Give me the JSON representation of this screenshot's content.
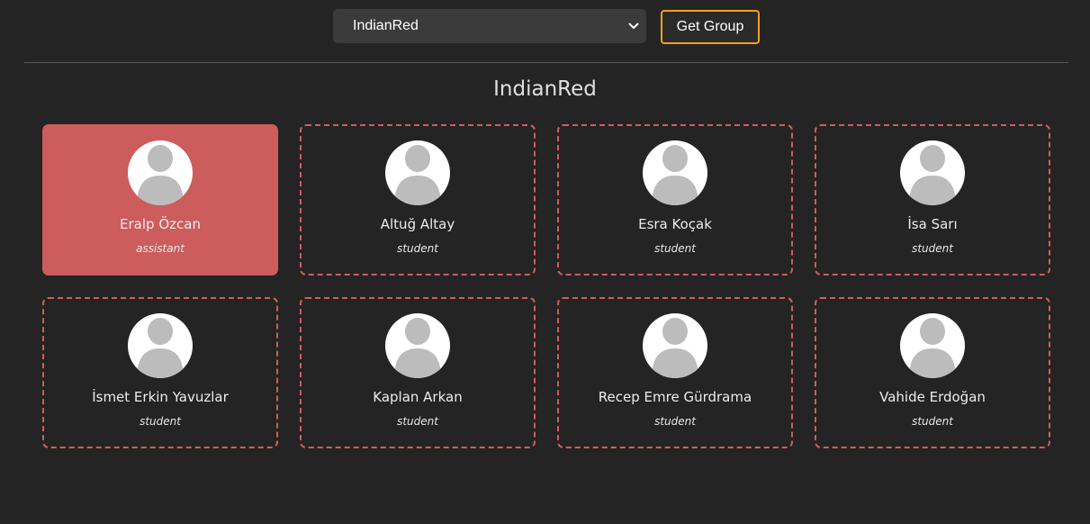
{
  "controls": {
    "group_select_value": "IndianRed",
    "get_group_label": "Get Group"
  },
  "group": {
    "title": "IndianRed",
    "accent_color": "#cd5c5c"
  },
  "members": [
    {
      "name": "Eralp Özcan",
      "role": "assistant",
      "highlighted": true
    },
    {
      "name": "Altuğ Altay",
      "role": "student",
      "highlighted": false
    },
    {
      "name": "Esra Koçak",
      "role": "student",
      "highlighted": false
    },
    {
      "name": "İsa Sarı",
      "role": "student",
      "highlighted": false
    },
    {
      "name": "İsmet Erkin Yavuzlar",
      "role": "student",
      "highlighted": false
    },
    {
      "name": "Kaplan Arkan",
      "role": "student",
      "highlighted": false
    },
    {
      "name": "Recep Emre Gürdrama",
      "role": "student",
      "highlighted": false
    },
    {
      "name": "Vahide Erdoğan",
      "role": "student",
      "highlighted": false
    }
  ],
  "icons": {
    "avatar": "user-avatar-icon",
    "select_arrow": "chevron-down-icon"
  }
}
